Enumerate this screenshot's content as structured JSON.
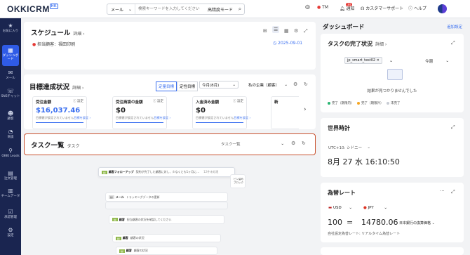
{
  "topbar": {
    "logo": "OKKICRM",
    "logo_badge": "HK",
    "search_type": "メール",
    "search_placeholder": "検索キーワードを入力してください",
    "search_mode": "高精度モード",
    "tm_label": "TM",
    "notify_label": "通知",
    "notify_count": "34",
    "support_label": "カスタマーサポート",
    "help_label": "ヘルプ"
  },
  "sidebar": {
    "items": [
      {
        "label": "お気に入り",
        "icon": "star-icon"
      },
      {
        "label": "ダッシュボード",
        "icon": "dashboard-icon"
      },
      {
        "label": "メール",
        "icon": "mail-icon"
      },
      {
        "label": "SNSチャット",
        "icon": "chat-icon"
      },
      {
        "label": "顧客",
        "icon": "customer-icon"
      },
      {
        "label": "商談",
        "icon": "deal-icon"
      },
      {
        "label": "OKKI Leads",
        "icon": "leads-icon"
      },
      {
        "label": "注文管理",
        "icon": "order-icon"
      },
      {
        "label": "チームデータ",
        "icon": "team-data-icon"
      },
      {
        "label": "承認管理",
        "icon": "approval-icon"
      },
      {
        "label": "設定",
        "icon": "settings-icon"
      }
    ]
  },
  "schedule": {
    "title": "スケジュール",
    "detail": "詳細",
    "owner_label": "担当顧客：福田印刷",
    "date": "2025-09-01"
  },
  "goals": {
    "title": "目標達成状況",
    "detail": "詳細",
    "tab_quant": "定量目標",
    "tab_qual": "定性目標",
    "period": "今月(8月)",
    "company": "私の企業（顧客）",
    "items": [
      {
        "title": "受注金額",
        "setting": "設定",
        "value": "$16,037.46",
        "note": "目標値が設定されていません",
        "link": "目標を設定"
      },
      {
        "title": "受注商談の金額",
        "setting": "設定",
        "value": "$0",
        "note": "目標値が設定されていません",
        "link": "目標を設定"
      },
      {
        "title": "入金済み金額",
        "setting": "設定",
        "value": "$0",
        "note": "目標値が設定されていません",
        "link": "目標を設定"
      }
    ],
    "more": "新"
  },
  "tasks": {
    "title": "タスク一覧",
    "subtitle": "タスク",
    "select": "タスク一覧",
    "rows": [
      {
        "tag": "顧客フォローアップ",
        "text": "契約が完了した顧客に対し、少なくとも1ヶ月に…",
        "extra": "12件未処理"
      },
      {
        "tag": "メール",
        "text": "トラッキングデータの更新"
      },
      {
        "tag": "顧客",
        "text": "担当顧客の状況を確認してください"
      },
      {
        "tag": "顧客",
        "text": "顧客の状況"
      },
      {
        "tag": "顧客",
        "text": "顧客の状況"
      }
    ],
    "popup": [
      "ピン留め",
      "ブロック"
    ]
  },
  "dashboard": {
    "title": "ダッシュボード",
    "add": "追加設定",
    "completion": {
      "title": "タスクの完了状況",
      "detail": "詳細",
      "filter_tag": "jp_smart_test02",
      "period": "今週",
      "empty": "結果が見つかりませんでした",
      "legend": [
        {
          "label": "完了（期限内）",
          "color": "#2bb673"
        },
        {
          "label": "完了（期限外）",
          "color": "#f5a623"
        },
        {
          "label": "未完了",
          "color": "#c8ccd4"
        }
      ]
    },
    "clock": {
      "title": "世界時計",
      "zone": "UTC+10: シドニー",
      "datetime": "8月 27  水  16:10:50"
    },
    "fx": {
      "title": "為替レート",
      "from": "USD",
      "to": "JPY",
      "amount": "100",
      "eq": "=",
      "result": "14780.06",
      "result_label": "日本銀行の換算価格",
      "note": "自社設定為替レート: リアルタイム為替レート"
    }
  }
}
